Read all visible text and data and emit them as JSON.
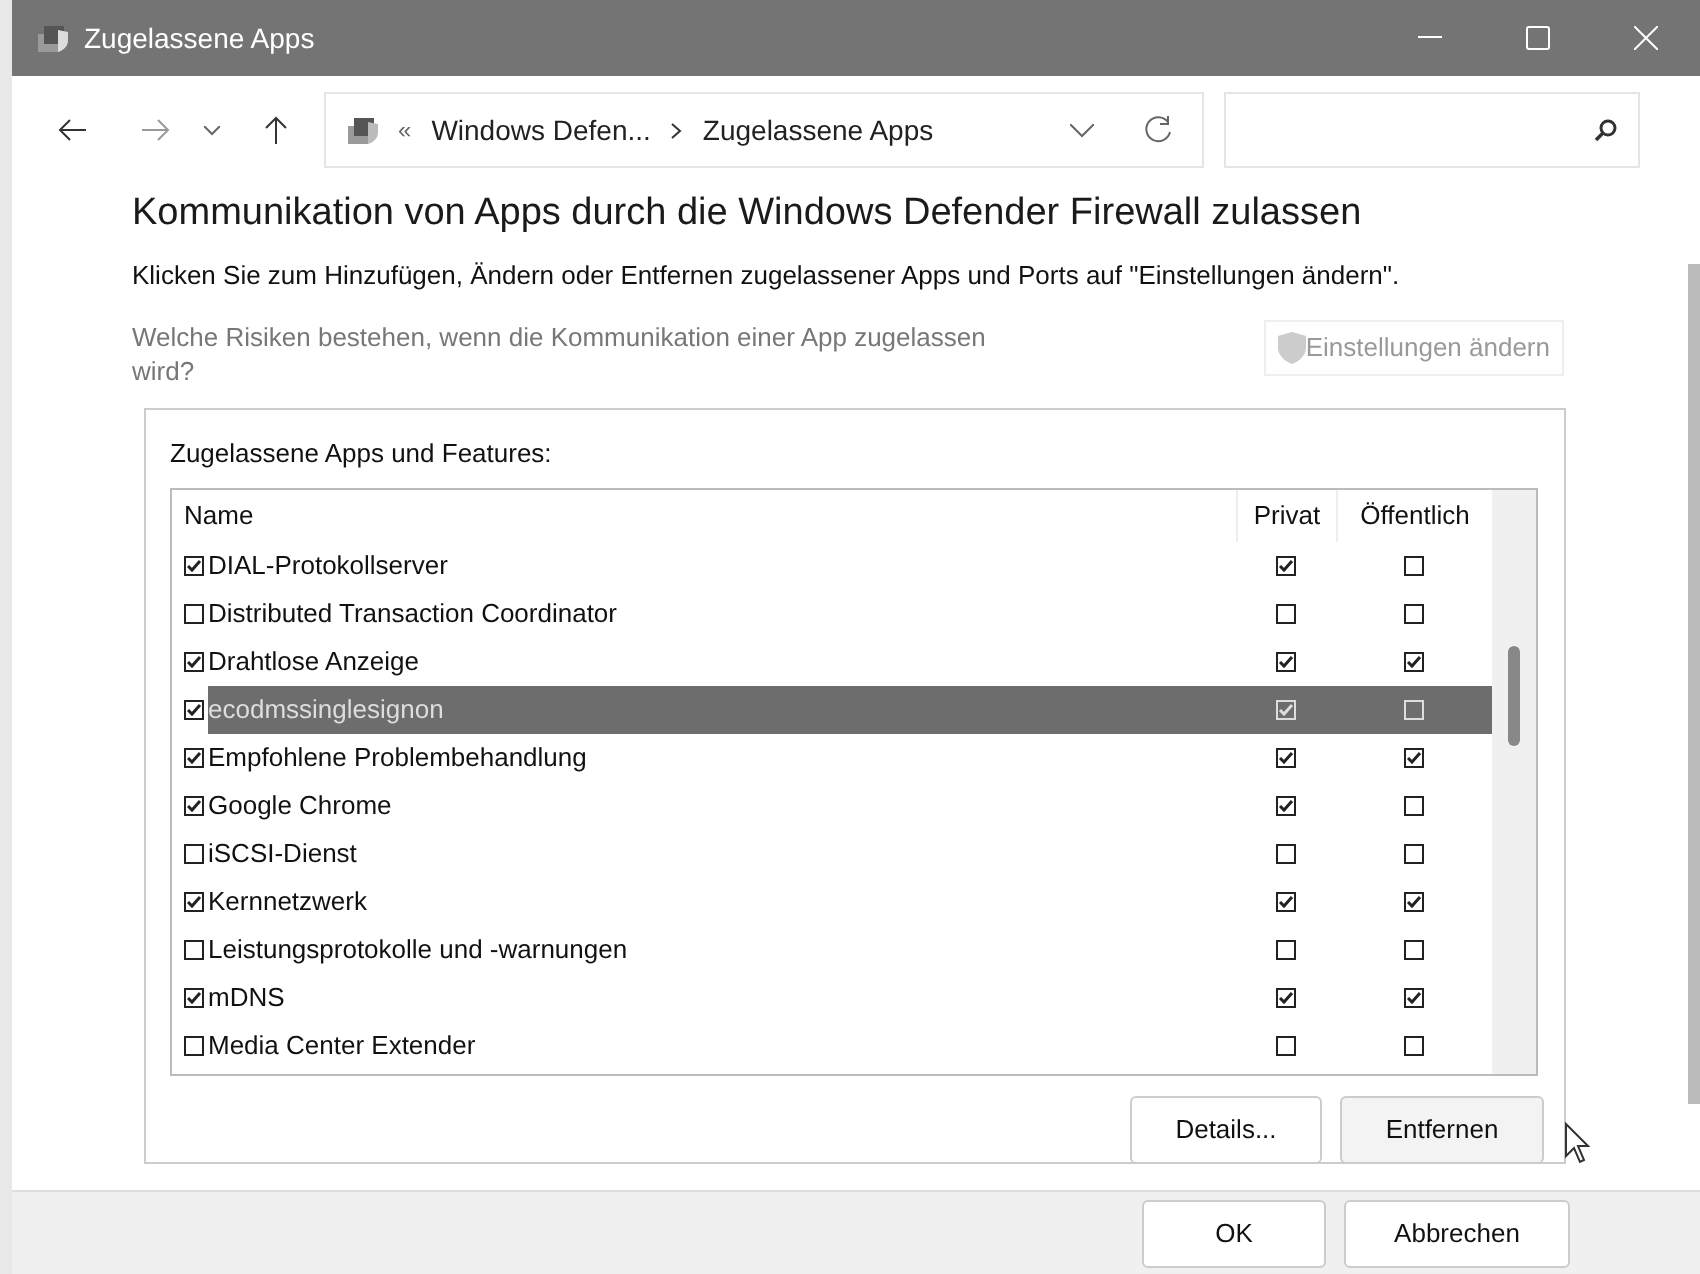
{
  "window": {
    "title": "Zugelassene Apps"
  },
  "address_bar": {
    "overflow": "«",
    "segments": [
      "Windows Defen...",
      "Zugelassene Apps"
    ]
  },
  "heading": "Kommunikation von Apps durch die Windows Defender Firewall zulassen",
  "instructions": "Klicken Sie zum Hinzufügen, Ändern oder Entfernen zugelassener Apps und Ports auf \"Einstellungen ändern\".",
  "risk_link": "Welche Risiken bestehen, wenn die Kommunikation einer App zugelassen wird?",
  "change_settings_button": {
    "label": "Einstellungen ändern",
    "disabled": true
  },
  "group": {
    "title": "Zugelassene Apps und Features:",
    "table": {
      "columns": [
        "Name",
        "Privat",
        "Öffentlich"
      ],
      "rows": [
        {
          "name": "DIAL-Protokollserver",
          "checked": true,
          "private": true,
          "public": false,
          "selected": false
        },
        {
          "name": "Distributed Transaction Coordinator",
          "checked": false,
          "private": false,
          "public": false,
          "selected": false
        },
        {
          "name": "Drahtlose Anzeige",
          "checked": true,
          "private": true,
          "public": true,
          "selected": false
        },
        {
          "name": "ecodmssinglesignon",
          "checked": true,
          "private": true,
          "public": false,
          "selected": true
        },
        {
          "name": "Empfohlene Problembehandlung",
          "checked": true,
          "private": true,
          "public": true,
          "selected": false
        },
        {
          "name": "Google Chrome",
          "checked": true,
          "private": true,
          "public": false,
          "selected": false
        },
        {
          "name": "iSCSI-Dienst",
          "checked": false,
          "private": false,
          "public": false,
          "selected": false
        },
        {
          "name": "Kernnetzwerk",
          "checked": true,
          "private": true,
          "public": true,
          "selected": false
        },
        {
          "name": "Leistungsprotokolle und -warnungen",
          "checked": false,
          "private": false,
          "public": false,
          "selected": false
        },
        {
          "name": "mDNS",
          "checked": true,
          "private": true,
          "public": true,
          "selected": false
        },
        {
          "name": "Media Center Extender",
          "checked": false,
          "private": false,
          "public": false,
          "selected": false
        }
      ]
    },
    "buttons": [
      "Details...",
      "Entfernen"
    ]
  },
  "footer_buttons": [
    "OK",
    "Abbrechen"
  ]
}
